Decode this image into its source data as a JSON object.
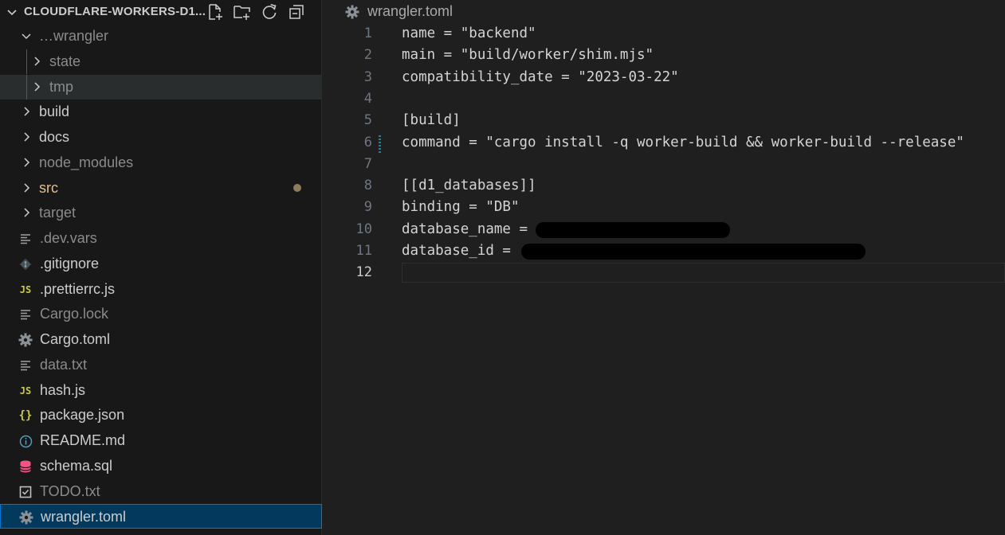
{
  "explorer": {
    "title": "CLOUDFLARE-WORKERS-D1...",
    "actions": [
      "new-file-icon",
      "new-folder-icon",
      "refresh-icon",
      "collapse-all-icon"
    ],
    "items": [
      {
        "label": "…wrangler",
        "type": "folder",
        "expanded": true,
        "color": "#8b8b8b",
        "icon": "chevron-down-icon"
      },
      {
        "label": "state",
        "type": "folder",
        "expanded": false,
        "color": "#8b8b8b",
        "icon": "chevron-right-icon"
      },
      {
        "label": "tmp",
        "type": "folder",
        "expanded": false,
        "color": "#8b8b8b",
        "icon": "chevron-right-icon"
      },
      {
        "label": "build",
        "type": "folder",
        "expanded": false,
        "color": "#cccccc",
        "icon": "chevron-right-icon"
      },
      {
        "label": "docs",
        "type": "folder",
        "expanded": false,
        "color": "#cccccc",
        "icon": "chevron-right-icon"
      },
      {
        "label": "node_modules",
        "type": "folder",
        "expanded": false,
        "color": "#8b8b8b",
        "icon": "chevron-right-icon"
      },
      {
        "label": "src",
        "type": "folder",
        "expanded": false,
        "color": "#e2c08d",
        "icon": "chevron-right-icon",
        "modified": true
      },
      {
        "label": "target",
        "type": "folder",
        "expanded": false,
        "color": "#8b8b8b",
        "icon": "chevron-right-icon"
      },
      {
        "label": ".dev.vars",
        "type": "file",
        "color": "#8b8b8b",
        "icon": "text-file-icon"
      },
      {
        "label": ".gitignore",
        "type": "file",
        "color": "#cccccc",
        "icon": "git-icon"
      },
      {
        "label": ".prettierrc.js",
        "type": "file",
        "color": "#cccccc",
        "icon": "javascript-icon"
      },
      {
        "label": "Cargo.lock",
        "type": "file",
        "color": "#8b8b8b",
        "icon": "text-file-icon"
      },
      {
        "label": "Cargo.toml",
        "type": "file",
        "color": "#cccccc",
        "icon": "gear-icon"
      },
      {
        "label": "data.txt",
        "type": "file",
        "color": "#8b8b8b",
        "icon": "text-file-icon"
      },
      {
        "label": "hash.js",
        "type": "file",
        "color": "#cccccc",
        "icon": "javascript-icon"
      },
      {
        "label": "package.json",
        "type": "file",
        "color": "#cccccc",
        "icon": "json-icon"
      },
      {
        "label": "README.md",
        "type": "file",
        "color": "#cccccc",
        "icon": "info-icon"
      },
      {
        "label": "schema.sql",
        "type": "file",
        "color": "#cccccc",
        "icon": "database-icon"
      },
      {
        "label": "TODO.txt",
        "type": "file",
        "color": "#8b8b8b",
        "icon": "checkbox-file-icon"
      },
      {
        "label": "wrangler.toml",
        "type": "file",
        "color": "#cccccc",
        "icon": "gear-icon",
        "selected": true
      }
    ]
  },
  "editor": {
    "breadcrumb": "wrangler.toml",
    "active_line": 12,
    "lines": [
      {
        "num": "1",
        "text": "name = \"backend\""
      },
      {
        "num": "2",
        "text": "main = \"build/worker/shim.mjs\""
      },
      {
        "num": "3",
        "text": "compatibility_date = \"2023-03-22\""
      },
      {
        "num": "4",
        "text": ""
      },
      {
        "num": "5",
        "text": "[build]"
      },
      {
        "num": "6",
        "text": "command = \"cargo install -q worker-build && worker-build --release\"",
        "modified": true
      },
      {
        "num": "7",
        "text": ""
      },
      {
        "num": "8",
        "text": "[[d1_databases]]"
      },
      {
        "num": "9",
        "text": "binding = \"DB\""
      },
      {
        "num": "10",
        "text": "database_name =",
        "redacted": true
      },
      {
        "num": "11",
        "text": "database_id =",
        "redacted": true
      },
      {
        "num": "12",
        "text": ""
      }
    ]
  },
  "colors": {
    "sidebar_bg": "#181818",
    "editor_bg": "#1f1f1f",
    "selection_bg": "#04395e",
    "selection_border": "#0078d4",
    "modified_dot": "#8c7c5a",
    "js_icon": "#cbcb41",
    "json_icon": "#cbcb41",
    "info_icon": "#519aba",
    "database_icon": "#f55385",
    "gear_icon": "#8a9199"
  }
}
